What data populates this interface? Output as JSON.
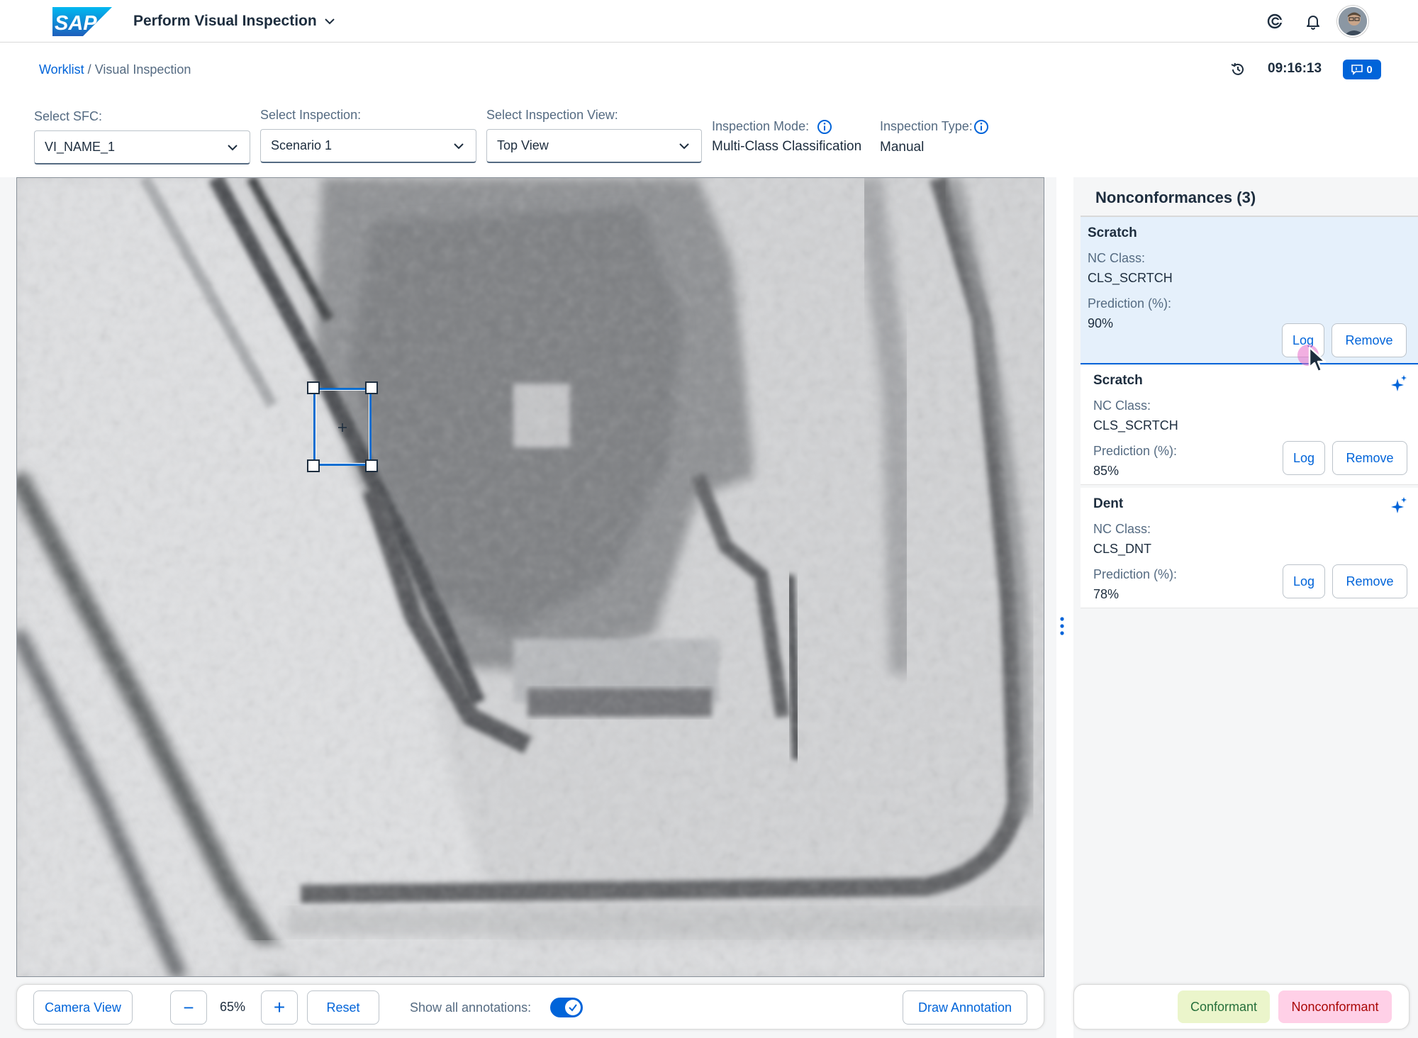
{
  "shell": {
    "app_title": "Perform Visual Inspection",
    "logo_text": "SAP",
    "icons": [
      "joule-icon",
      "notification-bell-icon",
      "user-avatar"
    ]
  },
  "header": {
    "breadcrumb_root": "Worklist",
    "breadcrumb_separator": " / ",
    "breadcrumb_current": "Visual Inspection",
    "time": "09:16:13",
    "message_count": "0"
  },
  "filters": {
    "sfc_label": "Select SFC:",
    "sfc_value": "VI_NAME_1",
    "inspection_label": "Select Inspection:",
    "inspection_value": "Scenario 1",
    "view_label": "Select Inspection View:",
    "view_value": "Top View",
    "mode_label": "Inspection Mode:",
    "mode_value": "Multi-Class Classification",
    "type_label": "Inspection Type:",
    "type_value": "Manual"
  },
  "viewer": {
    "camera_view_label": "Camera View",
    "zoom_out_label": "−",
    "zoom_value": "65%",
    "zoom_in_label": "+",
    "reset_label": "Reset",
    "show_annotations_label": "Show all annotations:",
    "show_annotations_on": true,
    "draw_annotation_label": "Draw Annotation"
  },
  "nonconformances": {
    "title": "Nonconformances (3)",
    "nc_class_label": "NC Class:",
    "prediction_label": "Prediction (%):",
    "log_label": "Log",
    "remove_label": "Remove",
    "items": [
      {
        "name": "Scratch",
        "nc_class": "CLS_SCRTCH",
        "prediction": "90%",
        "selected": true,
        "ai_suggested": false
      },
      {
        "name": "Scratch",
        "nc_class": "CLS_SCRTCH",
        "prediction": "85%",
        "selected": false,
        "ai_suggested": true
      },
      {
        "name": "Dent",
        "nc_class": "CLS_DNT",
        "prediction": "78%",
        "selected": false,
        "ai_suggested": true
      }
    ]
  },
  "actions": {
    "conformant_label": "Conformant",
    "nonconformant_label": "Nonconformant"
  },
  "colors": {
    "accent": "#0064d9",
    "conformant_bg": "#ebf5cb",
    "conformant_text": "#256f3a",
    "nonconformant_bg": "#ffd0e7",
    "nonconformant_text": "#aa0808",
    "selected_card_bg": "#e5f0fb"
  }
}
